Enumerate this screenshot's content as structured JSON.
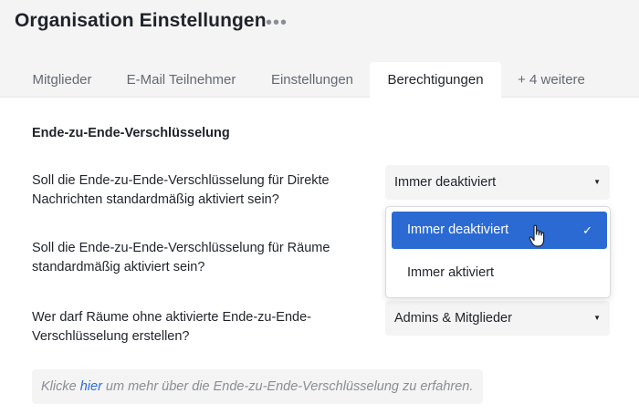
{
  "page": {
    "title": "Organisation Einstellungen",
    "more_icon": "more-horizontal-icon"
  },
  "tabs": [
    {
      "label": "Mitglieder",
      "active": false
    },
    {
      "label": "E-Mail Teilnehmer",
      "active": false
    },
    {
      "label": "Einstellungen",
      "active": false
    },
    {
      "label": "Berechtigungen",
      "active": true
    },
    {
      "label": "+ 4 weitere",
      "active": false
    }
  ],
  "section": {
    "heading": "Ende-zu-Ende-Verschlüsselung"
  },
  "settings": [
    {
      "question_line1": "Soll die Ende-zu-Ende-Verschlüsselung für Direkte",
      "question_line2": "Nachrichten standardmäßig aktiviert sein?",
      "selected": "Immer deaktiviert"
    },
    {
      "question_line1": "Soll die Ende-zu-Ende-Verschlüsselung für Räume",
      "question_line2": "standardmäßig aktiviert sein?"
    },
    {
      "question_line1": "Wer darf Räume ohne aktivierte Ende-zu-Ende-",
      "question_line2": "Verschlüsselung erstellen?",
      "selected": "Admins & Mitglieder"
    }
  ],
  "dropdown": {
    "options": [
      {
        "label": "Immer deaktiviert",
        "selected": true
      },
      {
        "label": "Immer aktiviert",
        "selected": false
      }
    ],
    "check_icon": "check-icon"
  },
  "info": {
    "prefix": "Klicke ",
    "link": "hier",
    "suffix": " um mehr über die Ende-zu-Ende-Verschlüsselung zu erfahren."
  },
  "colors": {
    "accent": "#2b6ad3",
    "header_bg": "#f4f4f5",
    "muted_text": "#8a8d93"
  }
}
